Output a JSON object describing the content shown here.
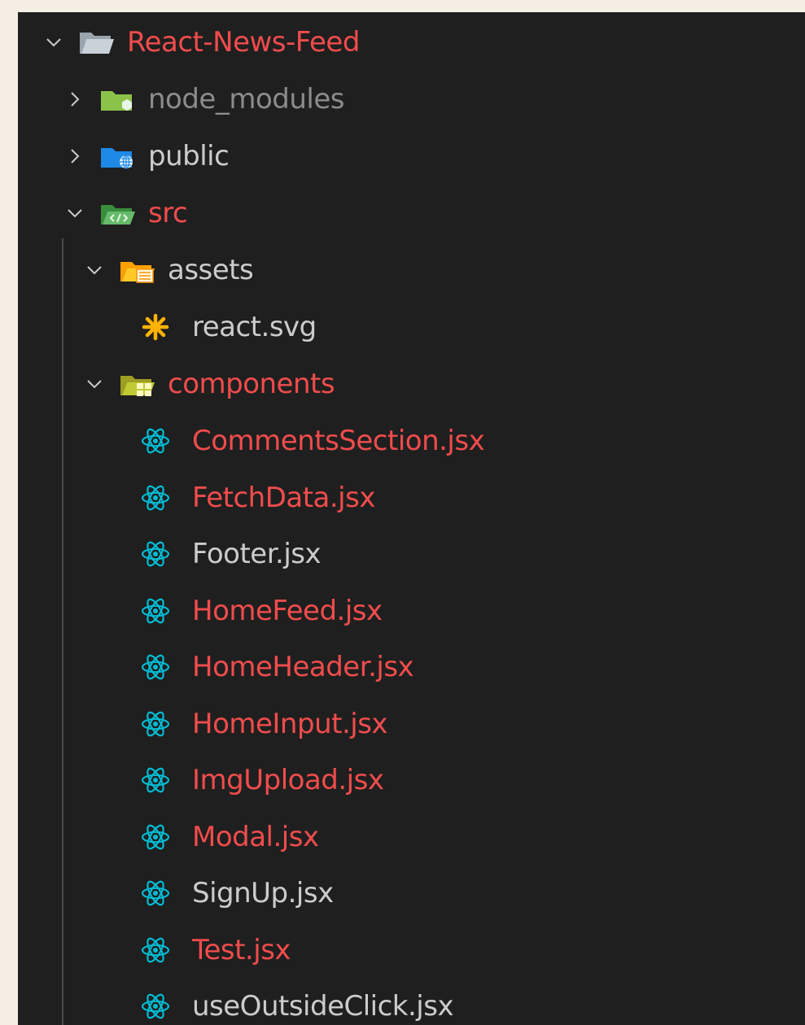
{
  "colors": {
    "modified": "#f14c4c",
    "normal": "#cccccc",
    "ignored": "#8c8c8c",
    "react": "#00bcd4",
    "background": "#1f1f1f"
  },
  "tree": {
    "root": {
      "label": "React-News-Feed",
      "expanded": true,
      "status": "modified"
    },
    "node_modules": {
      "label": "node_modules",
      "expanded": false,
      "status": "ignored"
    },
    "public": {
      "label": "public",
      "expanded": false,
      "status": "normal"
    },
    "src": {
      "label": "src",
      "expanded": true,
      "status": "modified"
    },
    "assets": {
      "label": "assets",
      "expanded": true,
      "status": "normal"
    },
    "react_svg": {
      "label": "react.svg",
      "status": "normal"
    },
    "components": {
      "label": "components",
      "expanded": true,
      "status": "modified"
    },
    "files": [
      {
        "label": "CommentsSection.jsx",
        "status": "modified"
      },
      {
        "label": "FetchData.jsx",
        "status": "modified"
      },
      {
        "label": "Footer.jsx",
        "status": "normal"
      },
      {
        "label": "HomeFeed.jsx",
        "status": "modified"
      },
      {
        "label": "HomeHeader.jsx",
        "status": "modified"
      },
      {
        "label": "HomeInput.jsx",
        "status": "modified"
      },
      {
        "label": "ImgUpload.jsx",
        "status": "modified"
      },
      {
        "label": "Modal.jsx",
        "status": "modified"
      },
      {
        "label": "SignUp.jsx",
        "status": "normal"
      },
      {
        "label": "Test.jsx",
        "status": "modified"
      },
      {
        "label": "useOutsideClick.jsx",
        "status": "normal"
      }
    ]
  },
  "icons": {
    "root": "folder-open-icon",
    "node_modules": "node-folder-icon",
    "public": "public-folder-icon",
    "src": "src-folder-icon",
    "assets": "assets-folder-icon",
    "react_svg": "svg-file-icon",
    "components": "components-folder-icon",
    "jsx": "react-icon"
  }
}
